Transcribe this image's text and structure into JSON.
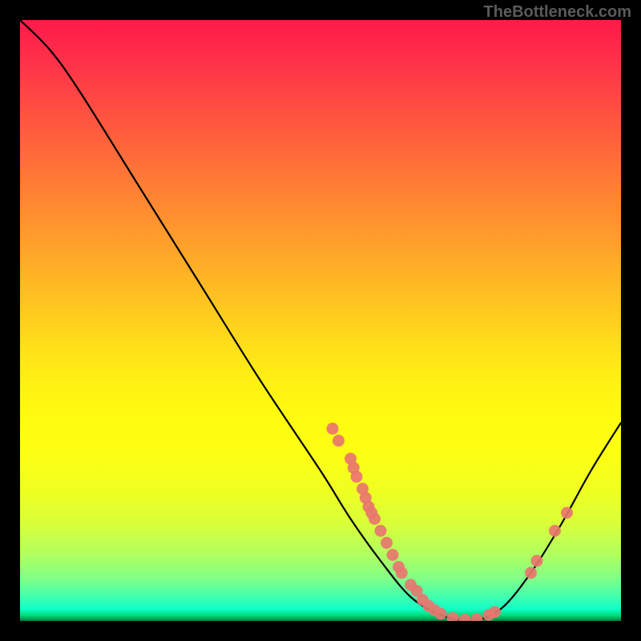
{
  "watermark": "TheBottleneck.com",
  "chart_data": {
    "type": "line",
    "title": "",
    "xlabel": "",
    "ylabel": "",
    "xlim": [
      0,
      100
    ],
    "ylim": [
      0,
      100
    ],
    "curve": [
      {
        "x": 0,
        "y": 100
      },
      {
        "x": 5,
        "y": 95
      },
      {
        "x": 10,
        "y": 88
      },
      {
        "x": 20,
        "y": 72
      },
      {
        "x": 30,
        "y": 56
      },
      {
        "x": 40,
        "y": 40
      },
      {
        "x": 50,
        "y": 25
      },
      {
        "x": 55,
        "y": 17
      },
      {
        "x": 60,
        "y": 10
      },
      {
        "x": 65,
        "y": 4
      },
      {
        "x": 70,
        "y": 1
      },
      {
        "x": 75,
        "y": 0
      },
      {
        "x": 80,
        "y": 2
      },
      {
        "x": 85,
        "y": 8
      },
      {
        "x": 90,
        "y": 16
      },
      {
        "x": 95,
        "y": 25
      },
      {
        "x": 100,
        "y": 33
      }
    ],
    "markers": [
      {
        "x": 52,
        "y": 32
      },
      {
        "x": 53,
        "y": 30
      },
      {
        "x": 55,
        "y": 27
      },
      {
        "x": 55.5,
        "y": 25.5
      },
      {
        "x": 56,
        "y": 24
      },
      {
        "x": 57,
        "y": 22
      },
      {
        "x": 57.5,
        "y": 20.5
      },
      {
        "x": 58,
        "y": 19
      },
      {
        "x": 58.5,
        "y": 18
      },
      {
        "x": 59,
        "y": 17
      },
      {
        "x": 60,
        "y": 15
      },
      {
        "x": 61,
        "y": 13
      },
      {
        "x": 62,
        "y": 11
      },
      {
        "x": 63,
        "y": 9
      },
      {
        "x": 63.5,
        "y": 8
      },
      {
        "x": 65,
        "y": 6
      },
      {
        "x": 66,
        "y": 5
      },
      {
        "x": 67,
        "y": 3.5
      },
      {
        "x": 68,
        "y": 2.5
      },
      {
        "x": 69,
        "y": 1.8
      },
      {
        "x": 70,
        "y": 1.2
      },
      {
        "x": 72,
        "y": 0.5
      },
      {
        "x": 74,
        "y": 0.2
      },
      {
        "x": 76,
        "y": 0.3
      },
      {
        "x": 78,
        "y": 1
      },
      {
        "x": 79,
        "y": 1.5
      },
      {
        "x": 85,
        "y": 8
      },
      {
        "x": 86,
        "y": 10
      },
      {
        "x": 89,
        "y": 15
      },
      {
        "x": 91,
        "y": 18
      }
    ],
    "gradient_stops": [
      {
        "pos": 0,
        "color": "#ff1a4a"
      },
      {
        "pos": 50,
        "color": "#ffde1a"
      },
      {
        "pos": 90,
        "color": "#80ff88"
      },
      {
        "pos": 100,
        "color": "#008040"
      }
    ]
  }
}
